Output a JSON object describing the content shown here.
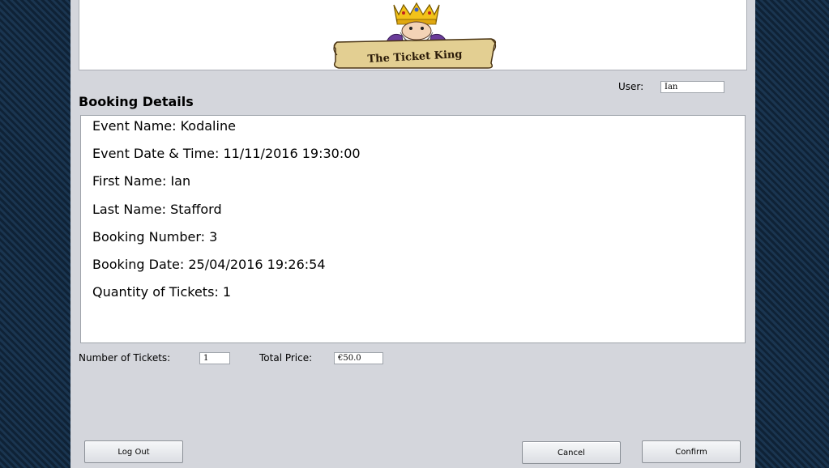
{
  "logo": {
    "text": "The Ticket King"
  },
  "user": {
    "label": "User:",
    "value": "Ian"
  },
  "section_title": "Booking Details",
  "details": [
    "Event Name: Kodaline",
    "Event Date & Time: 11/11/2016 19:30:00",
    "First Name: Ian",
    "Last Name: Stafford",
    "Booking Number: 3",
    "Booking Date: 25/04/2016 19:26:54",
    "Quantity of Tickets: 1"
  ],
  "tickets": {
    "label": "Number of Tickets:",
    "value": "1"
  },
  "price": {
    "label": "Total Price:",
    "value": "€50.0"
  },
  "buttons": {
    "logout": "Log Out",
    "cancel": "Cancel",
    "confirm": "Confirm"
  }
}
